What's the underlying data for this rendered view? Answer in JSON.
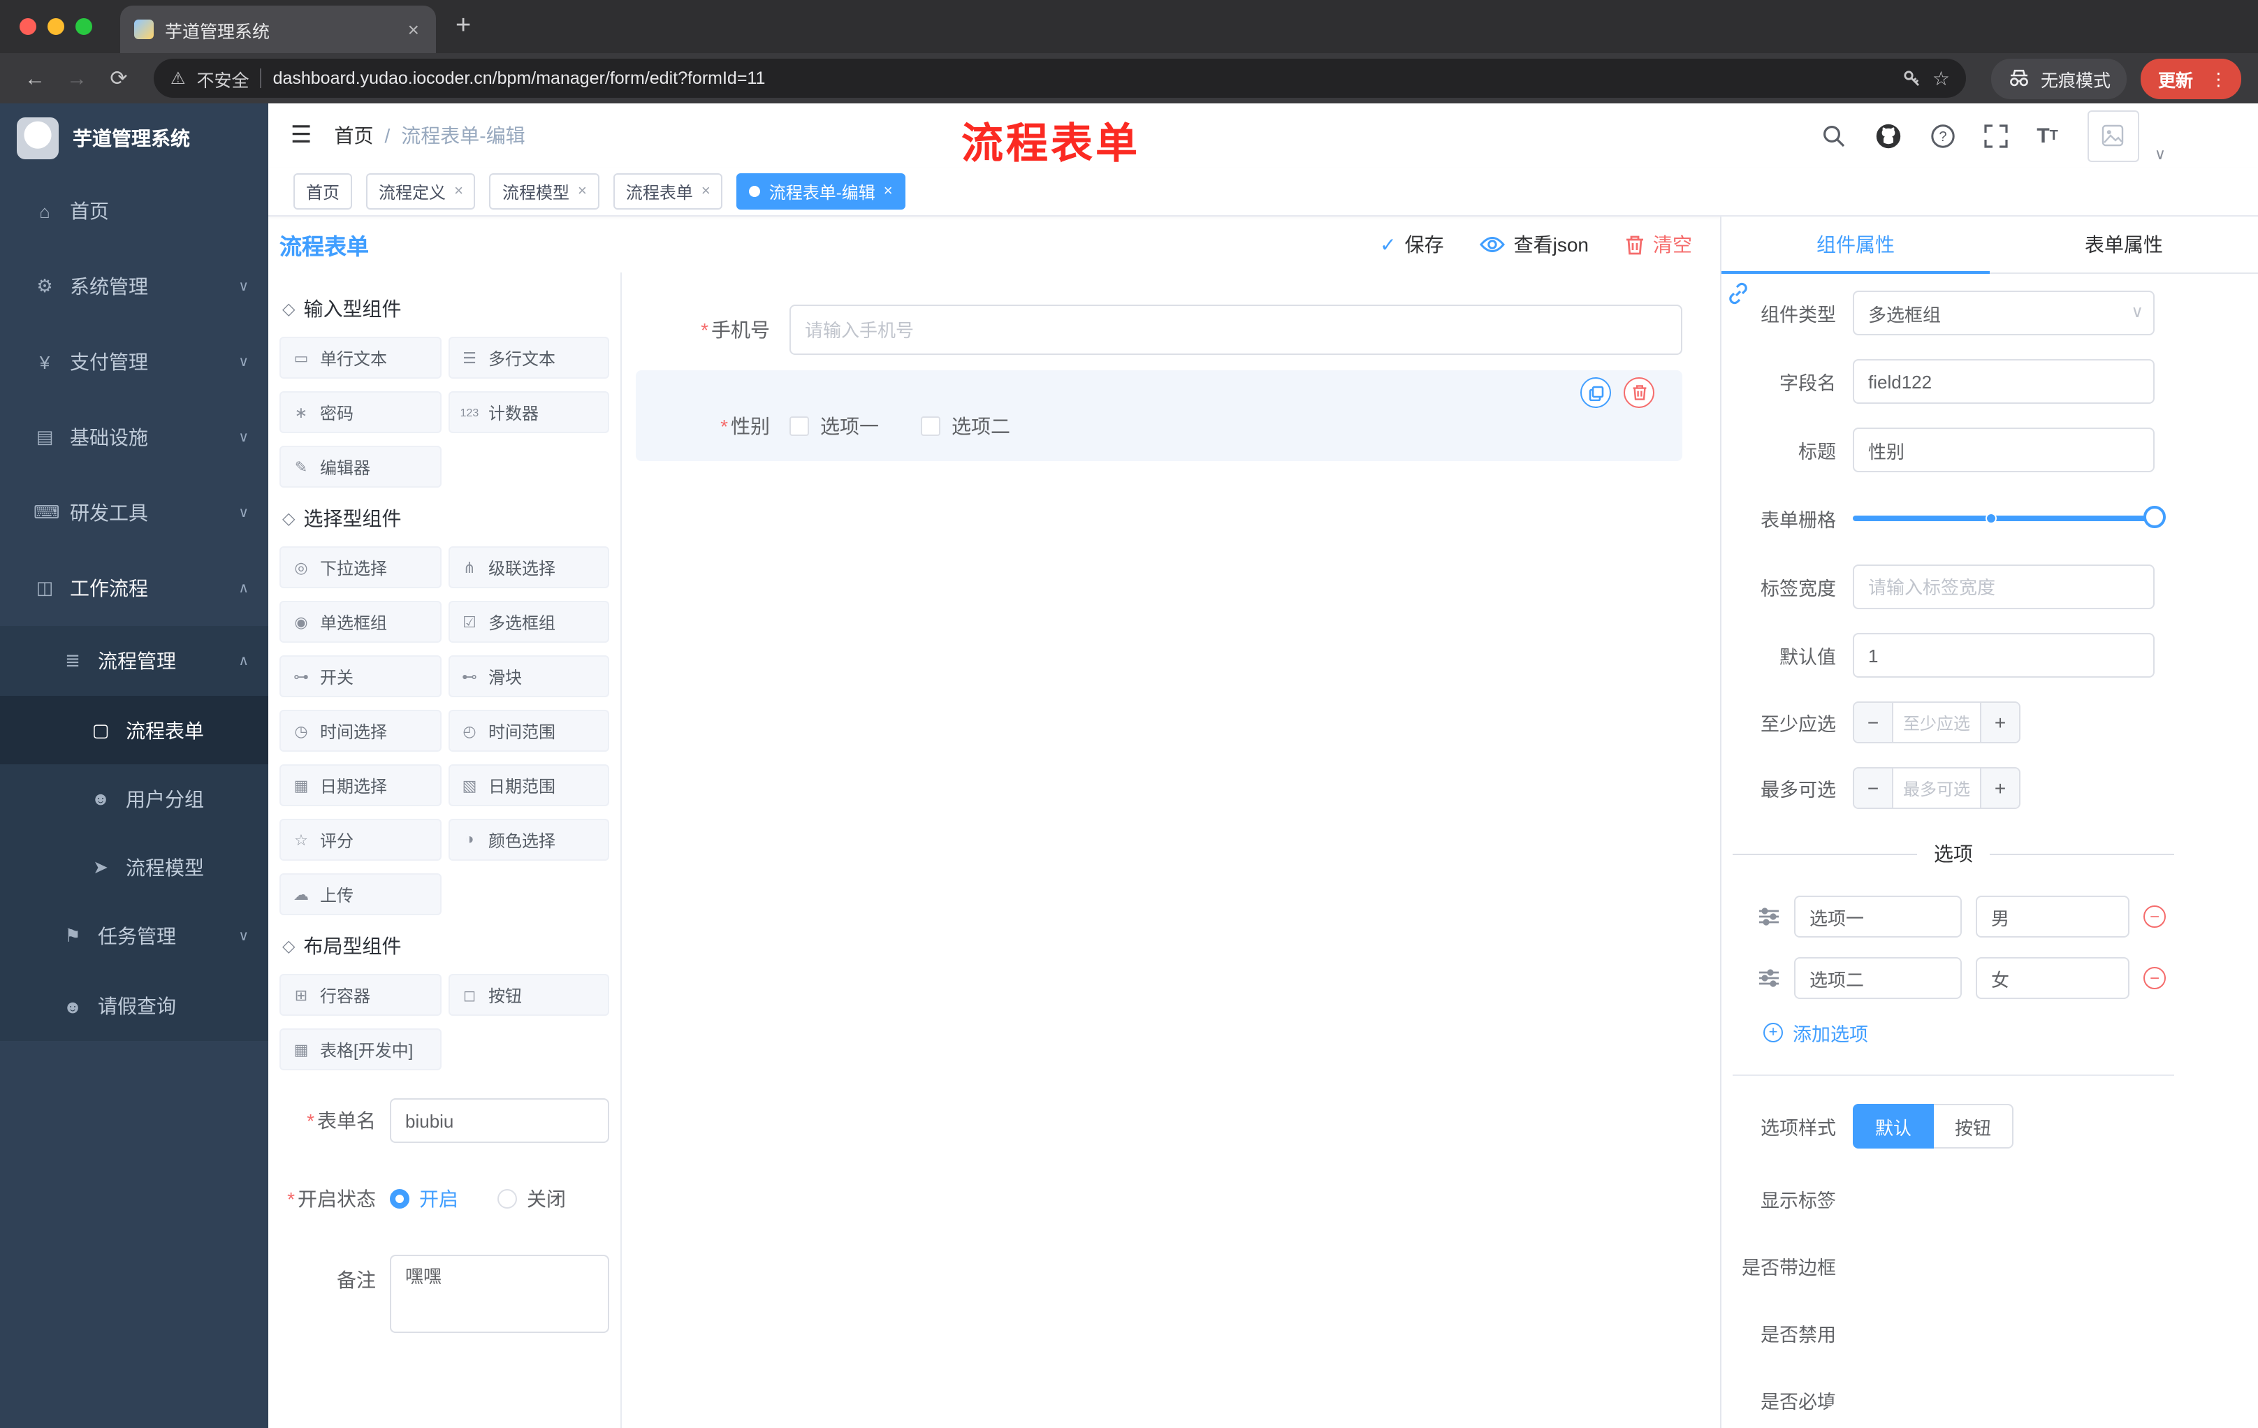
{
  "theme": {
    "primary": "#409EFF",
    "danger": "#F56C6C",
    "sidebar_bg": "#304156",
    "annotation_red": "#FB2A22"
  },
  "icons": {
    "back": "←",
    "forward": "→",
    "reload": "⟳",
    "warning": "⚠",
    "star": "☆",
    "plus": "+",
    "close": "×",
    "dots": "⋮",
    "caret_down": "∨",
    "caret_up": "∧",
    "hamburger": "☰",
    "check": "✓",
    "minus": "−",
    "group": "◇",
    "font_big": "T",
    "font_small": "T",
    "slash": "/"
  },
  "browser": {
    "tab_title": "芋道管理系统",
    "security_label": "不安全",
    "url": "dashboard.yudao.iocoder.cn/bpm/manager/form/edit?formId=11",
    "incognito_label": "无痕模式",
    "update_label": "更新"
  },
  "sidebar": {
    "logo_title": "芋道管理系统",
    "items": [
      {
        "icon": "⌂",
        "label": "首页"
      },
      {
        "icon": "⚙",
        "label": "系统管理",
        "chevron": "∨"
      },
      {
        "icon": "¥",
        "label": "支付管理",
        "chevron": "∨"
      },
      {
        "icon": "▤",
        "label": "基础设施",
        "chevron": "∨"
      },
      {
        "icon": "⌨",
        "label": "研发工具",
        "chevron": "∨"
      },
      {
        "icon": "◫",
        "label": "工作流程",
        "chevron": "∧"
      },
      {
        "icon": "≣",
        "label": "流程管理",
        "chevron": "∧"
      },
      {
        "icon": "▢",
        "label": "流程表单"
      },
      {
        "icon": "☻",
        "label": "用户分组"
      },
      {
        "icon": "➤",
        "label": "流程模型"
      },
      {
        "icon": "⚑",
        "label": "任务管理",
        "chevron": "∨"
      },
      {
        "icon": "☻",
        "label": "请假查询"
      }
    ]
  },
  "header": {
    "breadcrumb_home": "首页",
    "breadcrumb_sep": "/",
    "breadcrumb_current": "流程表单-编辑",
    "annotation": "流程表单"
  },
  "tags": [
    {
      "label": "首页"
    },
    {
      "label": "流程定义"
    },
    {
      "label": "流程模型"
    },
    {
      "label": "流程表单"
    },
    {
      "label": "流程表单-编辑"
    }
  ],
  "designer": {
    "title": "流程表单",
    "toolbar": {
      "save": "保存",
      "view_json": "查看json",
      "clear": "清空"
    },
    "groups": [
      {
        "icon": "◇",
        "title": "输入型组件",
        "items": [
          {
            "icon": "▭",
            "label": "单行文本"
          },
          {
            "icon": "☰",
            "label": "多行文本"
          },
          {
            "icon": "∗",
            "label": "密码"
          },
          {
            "icon": "123",
            "label": "计数器"
          },
          {
            "icon": "✎",
            "label": "编辑器"
          }
        ]
      },
      {
        "icon": "◇",
        "title": "选择型组件",
        "items": [
          {
            "icon": "◎",
            "label": "下拉选择"
          },
          {
            "icon": "⋔",
            "label": "级联选择"
          },
          {
            "icon": "◉",
            "label": "单选框组"
          },
          {
            "icon": "☑",
            "label": "多选框组"
          },
          {
            "icon": "⊶",
            "label": "开关"
          },
          {
            "icon": "⊷",
            "label": "滑块"
          },
          {
            "icon": "◷",
            "label": "时间选择"
          },
          {
            "icon": "◴",
            "label": "时间范围"
          },
          {
            "icon": "▦",
            "label": "日期选择"
          },
          {
            "icon": "▧",
            "label": "日期范围"
          },
          {
            "icon": "☆",
            "label": "评分"
          },
          {
            "icon": "◑",
            "label": "颜色选择"
          },
          {
            "icon": "☁",
            "label": "上传"
          }
        ]
      },
      {
        "icon": "◇",
        "title": "布局型组件",
        "items": [
          {
            "icon": "⊞",
            "label": "行容器"
          },
          {
            "icon": "◻",
            "label": "按钮"
          },
          {
            "icon": "▦",
            "label": "表格[开发中]"
          }
        ]
      }
    ],
    "meta": {
      "name_label": "表单名",
      "name_value": "biubiu",
      "status_label": "开启状态",
      "status_on": "开启",
      "status_off": "关闭",
      "remark_label": "备注",
      "remark_value": "嘿嘿"
    }
  },
  "canvas": {
    "phone": {
      "label": "手机号",
      "placeholder": "请输入手机号"
    },
    "gender": {
      "label": "性别",
      "option1": "选项一",
      "option2": "选项二"
    }
  },
  "props": {
    "tab_component": "组件属性",
    "tab_form": "表单属性",
    "rows": {
      "type_label": "组件类型",
      "type_value": "多选框组",
      "field_label": "字段名",
      "field_value": "field122",
      "title_label": "标题",
      "title_value": "性别",
      "grid_label": "表单栅格",
      "width_label": "标签宽度",
      "width_placeholder": "请输入标签宽度",
      "default_label": "默认值",
      "default_value": "1",
      "min_label": "至少应选",
      "min_placeholder": "至少应选",
      "max_label": "最多可选",
      "max_placeholder": "最多可选"
    },
    "options": {
      "divider": "选项",
      "rows": [
        {
          "label": "选项一",
          "value": "男"
        },
        {
          "label": "选项二",
          "value": "女"
        }
      ],
      "add": "添加选项"
    },
    "style": {
      "style_label": "选项样式",
      "style_default": "默认",
      "style_button": "按钮",
      "show_label": "显示标签",
      "border_label": "是否带边框",
      "disabled_label": "是否禁用",
      "required_label": "是否必填"
    }
  }
}
